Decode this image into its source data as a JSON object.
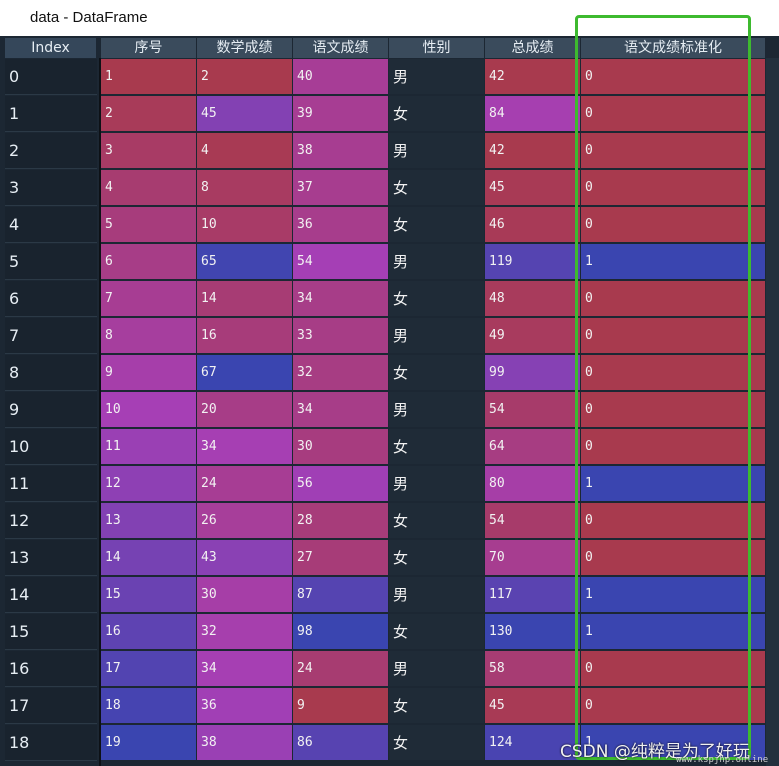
{
  "window": {
    "title": "data - DataFrame"
  },
  "columns": [
    "Index",
    "序号",
    "数学成绩",
    "语文成绩",
    "性别",
    "总成绩",
    "语文成绩标准化"
  ],
  "rows": [
    {
      "index": "0",
      "seq": "1",
      "math": "2",
      "chinese": "40",
      "gender": "男",
      "total": "42",
      "std": "0"
    },
    {
      "index": "1",
      "seq": "2",
      "math": "45",
      "chinese": "39",
      "gender": "女",
      "total": "84",
      "std": "0"
    },
    {
      "index": "2",
      "seq": "3",
      "math": "4",
      "chinese": "38",
      "gender": "男",
      "total": "42",
      "std": "0"
    },
    {
      "index": "3",
      "seq": "4",
      "math": "8",
      "chinese": "37",
      "gender": "女",
      "total": "45",
      "std": "0"
    },
    {
      "index": "4",
      "seq": "5",
      "math": "10",
      "chinese": "36",
      "gender": "女",
      "total": "46",
      "std": "0"
    },
    {
      "index": "5",
      "seq": "6",
      "math": "65",
      "chinese": "54",
      "gender": "男",
      "total": "119",
      "std": "1"
    },
    {
      "index": "6",
      "seq": "7",
      "math": "14",
      "chinese": "34",
      "gender": "女",
      "total": "48",
      "std": "0"
    },
    {
      "index": "7",
      "seq": "8",
      "math": "16",
      "chinese": "33",
      "gender": "男",
      "total": "49",
      "std": "0"
    },
    {
      "index": "8",
      "seq": "9",
      "math": "67",
      "chinese": "32",
      "gender": "女",
      "total": "99",
      "std": "0"
    },
    {
      "index": "9",
      "seq": "10",
      "math": "20",
      "chinese": "34",
      "gender": "男",
      "total": "54",
      "std": "0"
    },
    {
      "index": "10",
      "seq": "11",
      "math": "34",
      "chinese": "30",
      "gender": "女",
      "total": "64",
      "std": "0"
    },
    {
      "index": "11",
      "seq": "12",
      "math": "24",
      "chinese": "56",
      "gender": "男",
      "total": "80",
      "std": "1"
    },
    {
      "index": "12",
      "seq": "13",
      "math": "26",
      "chinese": "28",
      "gender": "女",
      "total": "54",
      "std": "0"
    },
    {
      "index": "13",
      "seq": "14",
      "math": "43",
      "chinese": "27",
      "gender": "女",
      "total": "70",
      "std": "0"
    },
    {
      "index": "14",
      "seq": "15",
      "math": "30",
      "chinese": "87",
      "gender": "男",
      "total": "117",
      "std": "1"
    },
    {
      "index": "15",
      "seq": "16",
      "math": "32",
      "chinese": "98",
      "gender": "女",
      "total": "130",
      "std": "1"
    },
    {
      "index": "16",
      "seq": "17",
      "math": "34",
      "chinese": "24",
      "gender": "男",
      "total": "58",
      "std": "0"
    },
    {
      "index": "17",
      "seq": "18",
      "math": "36",
      "chinese": "9",
      "gender": "女",
      "total": "45",
      "std": "0"
    },
    {
      "index": "18",
      "seq": "19",
      "math": "38",
      "chinese": "86",
      "gender": "女",
      "total": "124",
      "std": "1"
    }
  ],
  "colors": {
    "low": "#a83a4e",
    "mid": "#a63fb5",
    "high": "#3a45b0",
    "highlight_border": "#3dba2f"
  },
  "watermark": {
    "text": "CSDN @纯粹是为了好玩",
    "url_text": "www.kspjhp.online"
  }
}
